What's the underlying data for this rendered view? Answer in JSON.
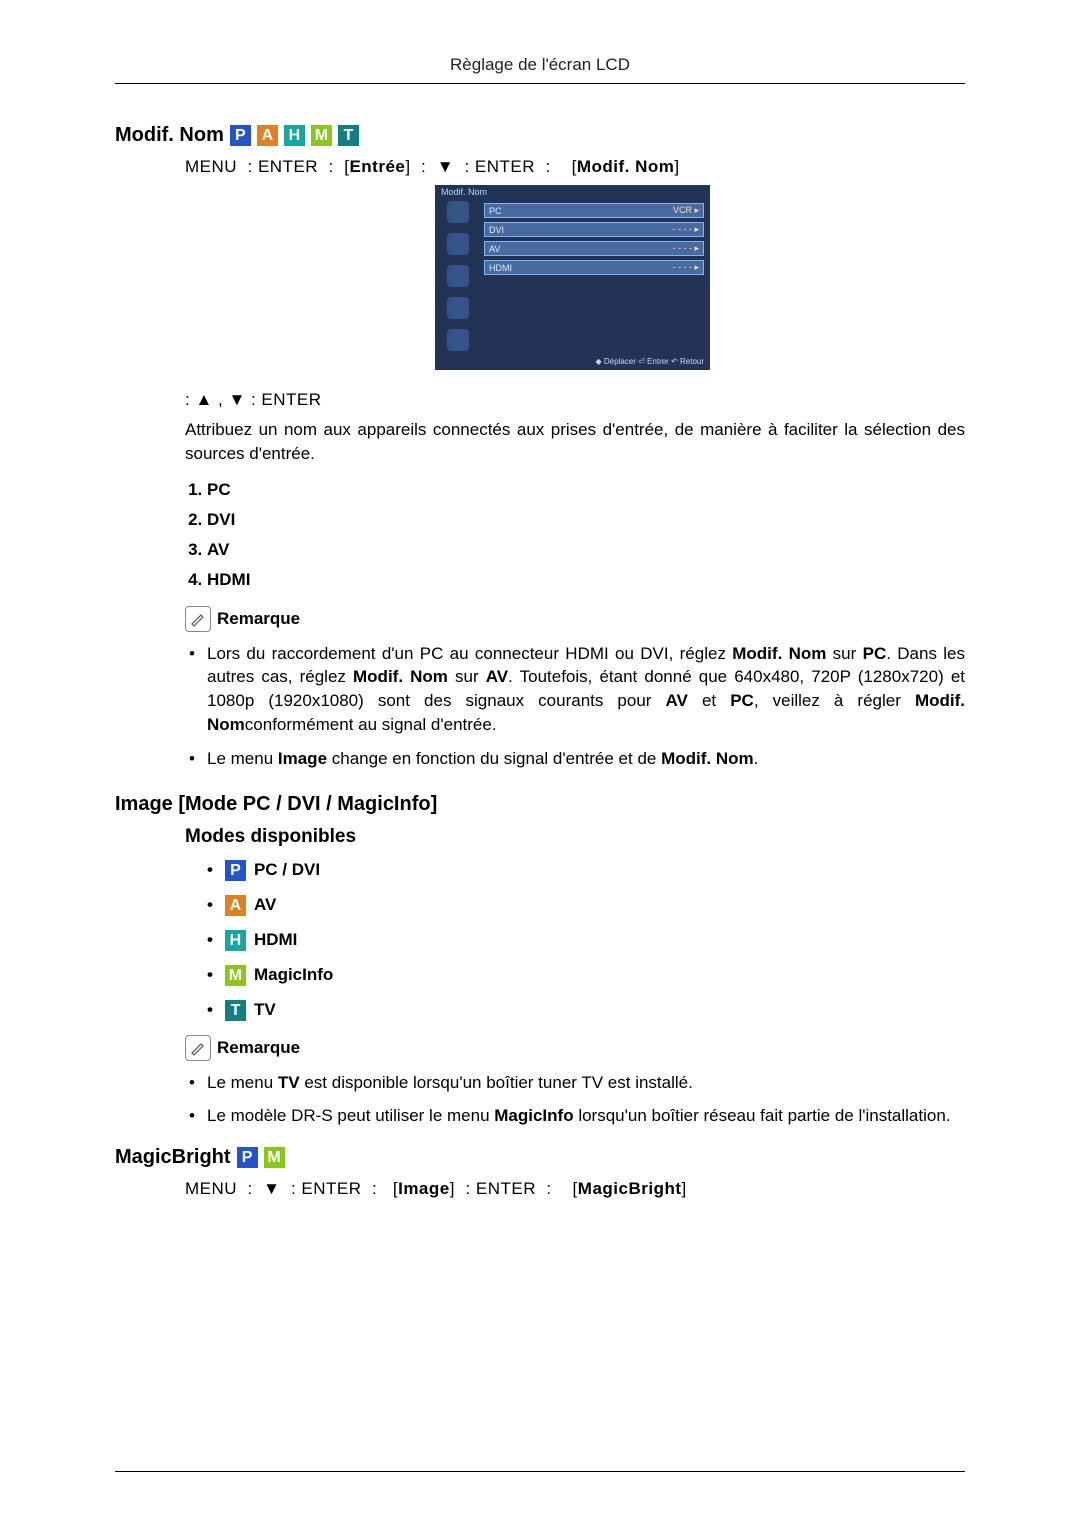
{
  "header": "Règlage de l'écran LCD",
  "section1": {
    "title": "Modif. Nom",
    "icons": [
      "P",
      "A",
      "H",
      "M",
      "T"
    ],
    "nav": {
      "menu": "MENU",
      "enter": "ENTER",
      "entree": "Entrée",
      "modifnom": "Modif. Nom"
    },
    "osd": {
      "title": "Modif. Nom",
      "rows": [
        {
          "l": "PC",
          "r": "VCR ▸"
        },
        {
          "l": "DVI",
          "r": "- - - - ▸"
        },
        {
          "l": "AV",
          "r": "- - - - ▸"
        },
        {
          "l": "HDMI",
          "r": "- - - - ▸"
        }
      ],
      "footer": "◆ Déplacer  ⏎ Entrer   ↶ Retour"
    },
    "nav2": ": ▲ , ▼   : ENTER",
    "para": "Attribuez un nom aux appareils connectés aux prises d'entrée, de manière à faciliter la sélection des sources d'entrée.",
    "list": [
      "PC",
      "DVI",
      "AV",
      "HDMI"
    ],
    "remarque": "Remarque",
    "notes": [
      "Lors du raccordement d'un PC au connecteur HDMI ou DVI, réglez <b>Modif. Nom</b> sur <b>PC</b>. Dans les autres cas, réglez <b>Modif. Nom</b> sur <b>AV</b>. Toutefois, étant donné que 640x480, 720P (1280x720) et 1080p (1920x1080) sont des signaux courants pour <b>AV</b> et <b>PC</b>, veillez à régler <b>Modif. Nom</b>conformément au signal d'entrée.",
      "Le menu <b>Image</b> change en fonction du signal d'entrée et de <b>Modif. Nom</b>."
    ]
  },
  "section2": {
    "title": "Image [Mode PC / DVI / MagicInfo]",
    "subtitle": "Modes disponibles",
    "modes": [
      {
        "icon": "P",
        "cls": "c-blue",
        "label": "PC / DVI"
      },
      {
        "icon": "A",
        "cls": "c-orange",
        "label": "AV"
      },
      {
        "icon": "H",
        "cls": "c-teal",
        "label": "HDMI"
      },
      {
        "icon": "M",
        "cls": "c-lime",
        "label": "MagicInfo"
      },
      {
        "icon": "T",
        "cls": "c-dteal",
        "label": "TV"
      }
    ],
    "remarque": "Remarque",
    "notes": [
      "Le menu <b>TV</b> est disponible lorsqu'un boîtier tuner TV est installé.",
      "Le modèle DR-S peut utiliser le menu <b>MagicInfo</b> lorsqu'un boîtier réseau fait partie de l'installation."
    ]
  },
  "section3": {
    "title": "MagicBright",
    "icons": [
      "P",
      "M"
    ],
    "nav": {
      "menu": "MENU",
      "enter": "ENTER",
      "image": "Image",
      "mb": "MagicBright"
    }
  }
}
